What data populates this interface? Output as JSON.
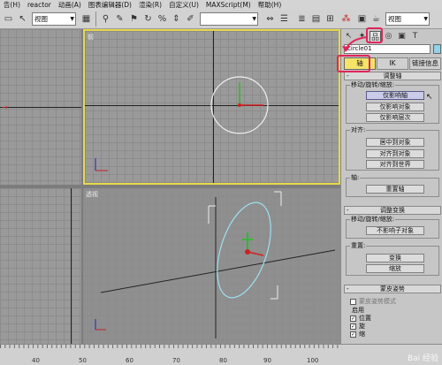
{
  "menu": [
    "告(H)",
    "reactor",
    "动画(A)",
    "图表编辑器(D)",
    "渲染(R)",
    "自定义(U)",
    "MAXScript(M)",
    "帮助(H)"
  ],
  "toolbar": {
    "selection_set_value": "视图",
    "filter_value": "",
    "right_view_value": "视图"
  },
  "viewports": {
    "top_left_label": "",
    "top_right_label": "前",
    "bottom_right_label": "透视"
  },
  "panel": {
    "tabs": [
      {
        "name": "pointer-icon",
        "glyph": "↖"
      },
      {
        "name": "create-icon",
        "glyph": "✦"
      },
      {
        "name": "hierarchy-icon",
        "glyph": "品"
      },
      {
        "name": "motion-icon",
        "glyph": "◎"
      },
      {
        "name": "display-icon",
        "glyph": "▣"
      },
      {
        "name": "utilities-icon",
        "glyph": "T"
      }
    ],
    "object_name": "Circle01",
    "color": "#8fd3e8",
    "sub_tabs": [
      "轴",
      "IK",
      "链接信息"
    ],
    "adjust_pivot": {
      "title": "调整轴",
      "group_move": "移动/旋转/缩放:",
      "btn_affect_pivot": "仅影响轴",
      "btn_affect_object": "仅影响对象",
      "btn_affect_hierarchy": "仅影响层次",
      "group_align": "对齐:",
      "btn_center": "居中到对象",
      "btn_align_object": "对齐到对象",
      "btn_align_world": "对齐到世界",
      "group_pivot": "轴:",
      "btn_reset_pivot": "重置轴"
    },
    "adjust_transform": {
      "title": "调整变换",
      "group_move": "移动/旋转/缩放:",
      "btn_dont_affect_children": "不影响子对象",
      "group_reset": "重置:",
      "btn_transform": "变换",
      "btn_scale": "缩放"
    },
    "skin_pose": {
      "title": "蒙皮姿势",
      "mode_label": "蒙皮姿势模式",
      "enable_label": "启用",
      "cb_position": "位置",
      "cb_rotation": "旋",
      "cb_scale": "缩"
    }
  },
  "ruler": {
    "numbers": [
      "40",
      "50",
      "60",
      "70",
      "80",
      "90",
      "100"
    ]
  },
  "watermark": "Bai 经验"
}
